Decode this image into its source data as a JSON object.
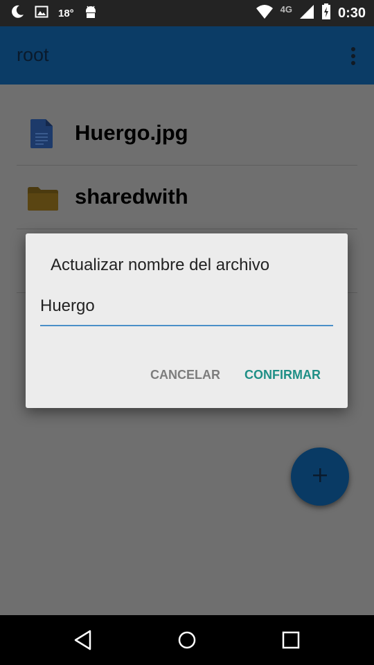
{
  "status_bar": {
    "temperature": "18°",
    "network": "4G",
    "time": "0:30"
  },
  "app_bar": {
    "title": "root"
  },
  "files": [
    {
      "name": "Huergo.jpg",
      "icon": "document-icon"
    },
    {
      "name": "sharedwith",
      "icon": "folder-icon"
    }
  ],
  "dialog": {
    "title": "Actualizar nombre del archivo",
    "input_value": "Huergo",
    "cancel_label": "CANCELAR",
    "confirm_label": "CONFIRMAR"
  },
  "fab": {
    "icon": "plus-icon"
  },
  "colors": {
    "app_bar": "#0b3c66",
    "accent": "#1f8f86",
    "input_underline": "#4a8fc8",
    "fab": "#093a64"
  }
}
